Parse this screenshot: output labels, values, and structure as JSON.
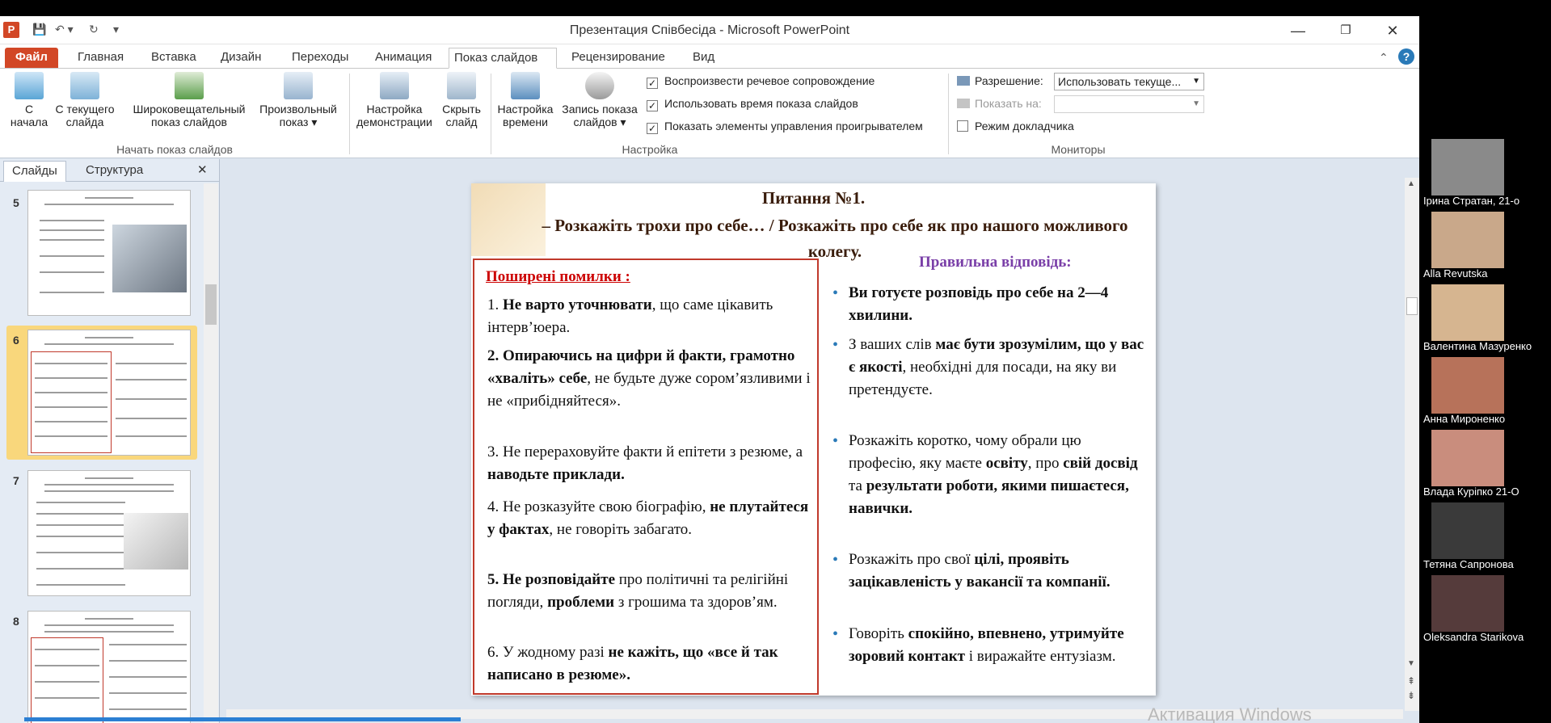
{
  "window": {
    "title": "Презентация Співбесіда  -  Microsoft PowerPoint",
    "app_icon": "P"
  },
  "tabs": [
    {
      "label": "Файл"
    },
    {
      "label": "Главная"
    },
    {
      "label": "Вставка"
    },
    {
      "label": "Дизайн"
    },
    {
      "label": "Переходы"
    },
    {
      "label": "Анимация"
    },
    {
      "label": "Показ слайдов"
    },
    {
      "label": "Рецензирование"
    },
    {
      "label": "Вид"
    }
  ],
  "ribbon": {
    "btn_from_start": [
      "С",
      "начала"
    ],
    "btn_from_current": [
      "С текущего",
      "слайда"
    ],
    "btn_broadcast": [
      "Широковещательный",
      "показ слайдов"
    ],
    "btn_custom": [
      "Произвольный",
      "показ ▾"
    ],
    "group_start": "Начать показ слайдов",
    "btn_setup": [
      "Настройка",
      "демонстрации"
    ],
    "btn_hide": [
      "Скрыть",
      "слайд"
    ],
    "btn_timings": [
      "Настройка",
      "времени"
    ],
    "btn_record": [
      "Запись показа",
      "слайдов ▾"
    ],
    "chk_narration": "Воспроизвести речевое сопровождение",
    "chk_timings": "Использовать время показа слайдов",
    "chk_controls": "Показать элементы управления проигрывателем",
    "group_setup": "Настройка",
    "resolution_label": "Разрешение:",
    "resolution_value": "Использовать текуще...",
    "show_on_label": "Показать на:",
    "presenter_view": "Режим докладчика",
    "group_monitors": "Мониторы"
  },
  "pane": {
    "tab_slides": "Слайды",
    "tab_outline": "Структура",
    "close": "✕",
    "thumb_numbers": [
      "5",
      "6",
      "7",
      "8"
    ]
  },
  "slide": {
    "title": "Питання №1.",
    "question": "– Розкажіть трохи про себе… / Розкажіть про себе як про нашого можливого колегу.",
    "mistakes_head": "Поширені помилки :",
    "mistakes": [
      {
        "num": "1.",
        "bold": "Не варто уточнювати",
        "rest": ", що саме цікавить інтерв’юера."
      },
      {
        "num": "2.",
        "bold": "Опираючись  на цифри й факти, грамотно «хваліть» себе",
        "rest": ", не будьте дуже сором’язливими і не «прибідняйтеся»."
      },
      {
        "num": "3.",
        "pre": "Не перераховуйте факти й епітети з резюме, а ",
        "bold": "наводьте приклади."
      },
      {
        "num": "4.",
        "pre": "Не розказуйте свою біографію, ",
        "bold": "не плутайтеся у фактах",
        "rest": ", не говоріть забагато."
      },
      {
        "num": "5.",
        "bold": "Не розповідайте",
        "rest": " про політичні та релігійні погляди, ",
        "bold2": "проблеми",
        "rest2": " з грошима та здоров’ям."
      },
      {
        "num": "6.",
        "pre": "У жодному разі ",
        "bold": "не кажіть, що «все й так написано в резюме»."
      }
    ],
    "right_head": "Правильна відповідь:",
    "answers": [
      {
        "bold": "Ви готуєте розповідь про себе на 2—4 хвилини."
      },
      {
        "pre": " З ваших слів ",
        "bold": "має бути зрозумілим, що у вас є якості",
        "rest": ", необхідні для посади, на яку ви претендуєте."
      },
      {
        "pre": "Розкажіть коротко, чому обрали цю професію, яку маєте ",
        "bold": "освіту",
        "rest": ", про ",
        "bold2": "свій досвід",
        "rest2": " та ",
        "bold3": "результати роботи, якими пишаєтеся, навички."
      },
      {
        "pre": "Розкажіть про свої ",
        "bold": "цілі, проявіть зацікавленість у вакансії та компанії."
      },
      {
        "pre": "Говоріть ",
        "bold": "спокійно, впевнено, утримуйте зоровий контакт",
        "rest": " і виражайте ентузіазм."
      }
    ]
  },
  "participants": [
    {
      "name": "Ірина Стратан, 21-о",
      "color": "#8a8a8a"
    },
    {
      "name": "Alla Revutska",
      "color": "#c9a88a"
    },
    {
      "name": "Валентина Мазуренко",
      "color": "#d6b590"
    },
    {
      "name": "Анна Мироненко",
      "color": "#b7725a"
    },
    {
      "name": "Влада Курiпко 21-О",
      "color": "#c98d7d"
    },
    {
      "name": "Тетяна Сапронова",
      "color": "#3a3a3a"
    },
    {
      "name": "Oleksandra Starikova",
      "color": "#553b3b"
    }
  ],
  "activation": "Активация Windows"
}
